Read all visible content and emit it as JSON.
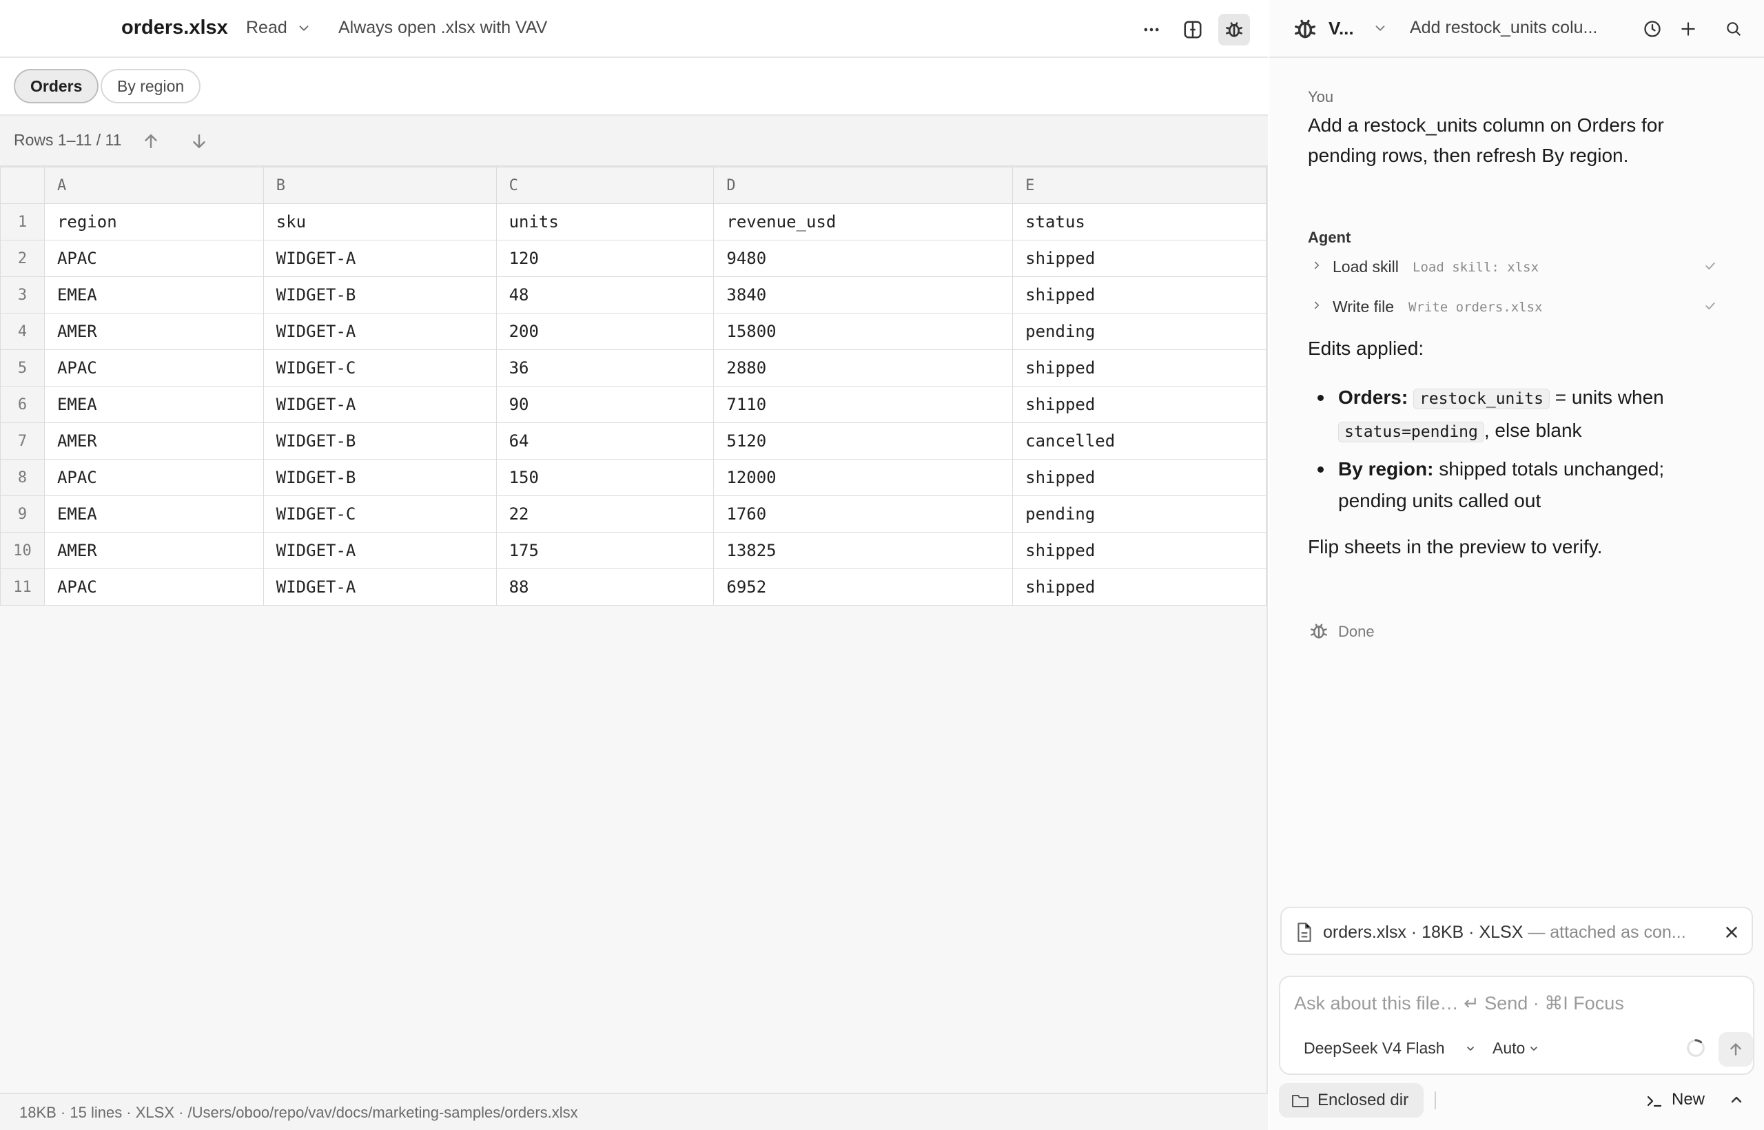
{
  "header": {
    "file_title": "orders.xlsx",
    "mode": "Read",
    "always_open": "Always open .xlsx with VAV"
  },
  "sheets": {
    "tabs": [
      "Orders",
      "By region"
    ],
    "active": "Orders"
  },
  "rows_info": {
    "label": "Rows 1–11 / 11"
  },
  "grid": {
    "columns": [
      "A",
      "B",
      "C",
      "D",
      "E"
    ],
    "rows": [
      [
        "region",
        "sku",
        "units",
        "revenue_usd",
        "status"
      ],
      [
        "APAC",
        "WIDGET-A",
        "120",
        "9480",
        "shipped"
      ],
      [
        "EMEA",
        "WIDGET-B",
        "48",
        "3840",
        "shipped"
      ],
      [
        "AMER",
        "WIDGET-A",
        "200",
        "15800",
        "pending"
      ],
      [
        "APAC",
        "WIDGET-C",
        "36",
        "2880",
        "shipped"
      ],
      [
        "EMEA",
        "WIDGET-A",
        "90",
        "7110",
        "shipped"
      ],
      [
        "AMER",
        "WIDGET-B",
        "64",
        "5120",
        "cancelled"
      ],
      [
        "APAC",
        "WIDGET-B",
        "150",
        "12000",
        "shipped"
      ],
      [
        "EMEA",
        "WIDGET-C",
        "22",
        "1760",
        "pending"
      ],
      [
        "AMER",
        "WIDGET-A",
        "175",
        "13825",
        "shipped"
      ],
      [
        "APAC",
        "WIDGET-A",
        "88",
        "6952",
        "shipped"
      ]
    ]
  },
  "statusbar": {
    "text": "18KB · 15 lines · XLSX · /Users/oboo/repo/vav/docs/marketing-samples/orders.xlsx"
  },
  "panel": {
    "agent_name": "V...",
    "thread_title": "Add restock_units colu...",
    "you_label": "You",
    "user_message": "Add a restock_units column on Orders for pending rows, then refresh By region.",
    "agent_label": "Agent",
    "tools": [
      {
        "name": "Load skill",
        "detail": "Load skill: xlsx"
      },
      {
        "name": "Write file",
        "detail": "Write orders.xlsx"
      }
    ],
    "edits_title": "Edits applied:",
    "edit_1": {
      "bold": "Orders:",
      "code_1": "restock_units",
      "text_1": "= units when",
      "code_2": "status=pending",
      "text_2": ", else blank"
    },
    "edit_2": {
      "bold": "By region:",
      "text": "shipped totals unchanged; pending units called out"
    },
    "flip_note": "Flip sheets in the preview to verify.",
    "done_text": "Done"
  },
  "attachment": {
    "name": "orders.xlsx · 18KB · XLSX",
    "note": " — attached as con..."
  },
  "composer": {
    "placeholder": "Ask about this file… ↵ Send · ⌘I Focus",
    "model": "DeepSeek V4 Flash",
    "mode": "Auto"
  },
  "footer": {
    "enclosed_dir": "Enclosed dir",
    "new_label": "New"
  },
  "colors": {
    "accent_bg": "#e7e7e7",
    "check": "#8a8a8a"
  }
}
